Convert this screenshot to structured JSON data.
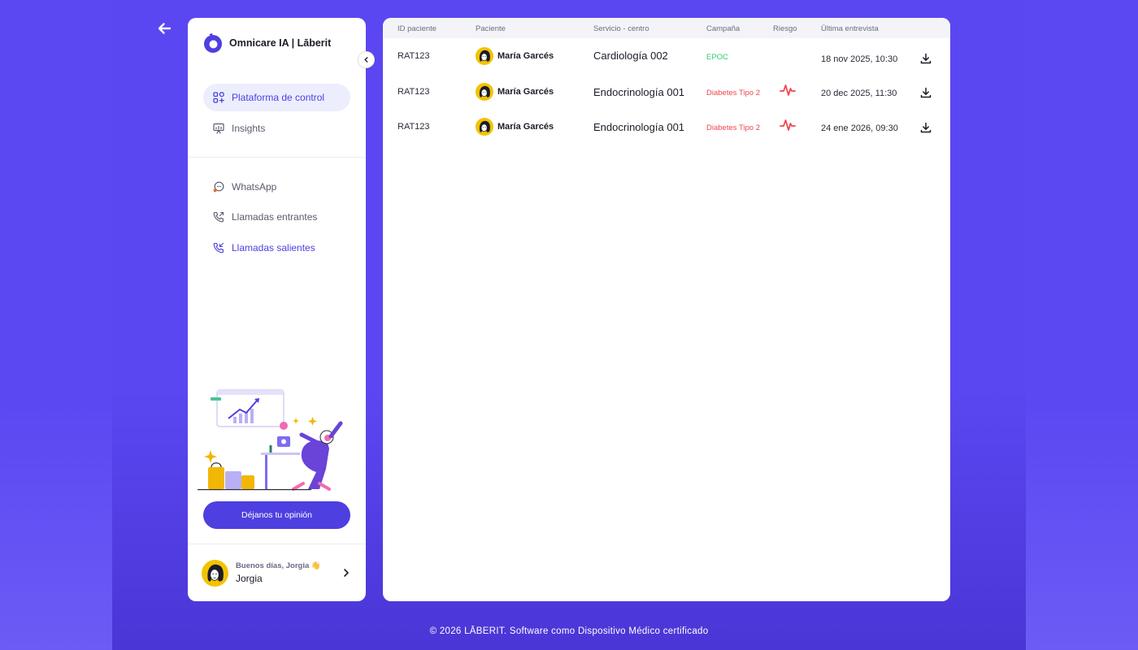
{
  "brand": {
    "name": "Omnicare IA | Lāberit"
  },
  "colors": {
    "accent": "#4e3fe0",
    "background": "#5b48f2",
    "campaign_green": "#2ecc71",
    "campaign_red": "#f0464d",
    "risk_red": "#f0464d"
  },
  "sidebar": {
    "nav_top": [
      {
        "label": "Plataforma de control",
        "icon": "dashboard-grid-icon",
        "active": true
      },
      {
        "label": "Insights",
        "icon": "presentation-chart-icon",
        "active": false
      }
    ],
    "nav_channels": [
      {
        "label": "WhatsApp",
        "icon": "chat-bubble-icon"
      },
      {
        "label": "Llamadas entrantes",
        "icon": "phone-incoming-icon"
      },
      {
        "label": "Llamadas salientes",
        "icon": "phone-outgoing-icon"
      }
    ],
    "feedback_label": "Déjanos tu opinión",
    "user": {
      "greeting": "Buenos días, Jorgia 👋",
      "name": "Jorgia"
    }
  },
  "table": {
    "columns": [
      "ID paciente",
      "Paciente",
      "Servicio - centro",
      "Campaña",
      "Riesgo",
      "Última entrevista"
    ],
    "rows": [
      {
        "id": "RAT123",
        "patient": "María Garcés",
        "service": "Cardiología 002",
        "campaign": "EPOC",
        "campaign_color": "green",
        "risk": false,
        "date": "18 nov 2025, 10:30"
      },
      {
        "id": "RAT123",
        "patient": "María Garcés",
        "service": "Endocrinología 001",
        "campaign": "Diabetes Tipo 2",
        "campaign_color": "red",
        "risk": true,
        "date": "20 dec 2025, 11:30"
      },
      {
        "id": "RAT123",
        "patient": "María Garcés",
        "service": "Endocrinología 001",
        "campaign": "Diabetes Tipo 2",
        "campaign_color": "red",
        "risk": true,
        "date": "24 ene 2026, 09:30"
      }
    ]
  },
  "footer": {
    "text": "© 2026 LĀBERIT. Software como Dispositivo Médico certificado"
  }
}
